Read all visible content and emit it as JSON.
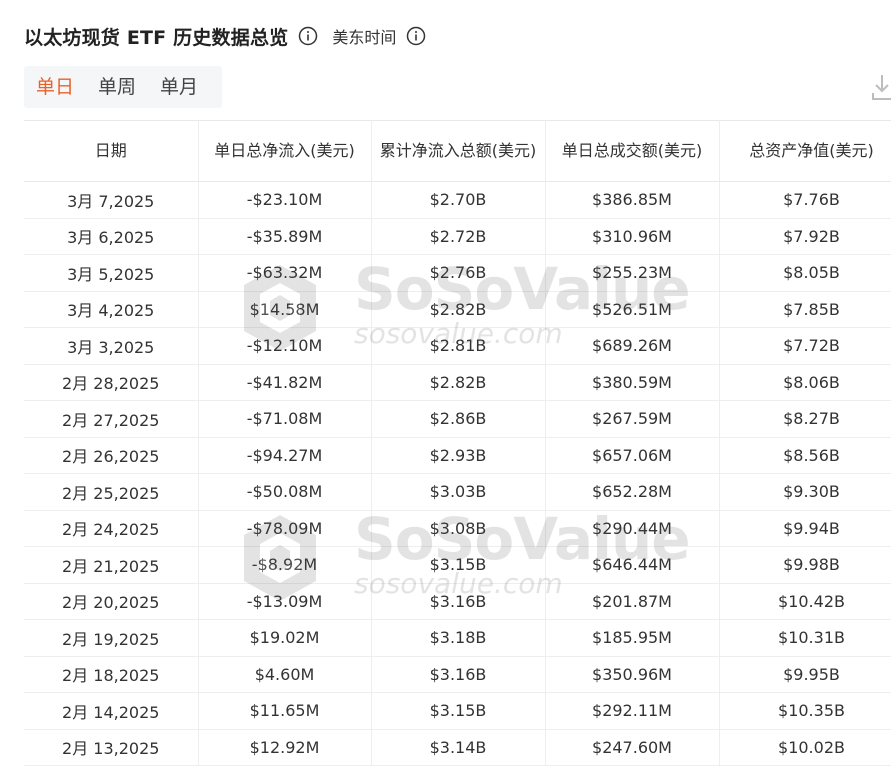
{
  "header": {
    "title": "以太坊现货 ETF 历史数据总览",
    "timezone": "美东时间"
  },
  "tabs": [
    "单日",
    "单周",
    "单月"
  ],
  "active_tab": "单日",
  "table": {
    "columns": [
      "日期",
      "单日总净流入(美元)",
      "累计净流入总额(美元)",
      "单日总成交额(美元)",
      "总资产净值(美元)"
    ],
    "rows": [
      {
        "date": "3月 7,2025",
        "net_inflow": "-$23.10M",
        "cumulative": "$2.70B",
        "volume": "$386.85M",
        "nav": "$7.76B"
      },
      {
        "date": "3月 6,2025",
        "net_inflow": "-$35.89M",
        "cumulative": "$2.72B",
        "volume": "$310.96M",
        "nav": "$7.92B"
      },
      {
        "date": "3月 5,2025",
        "net_inflow": "-$63.32M",
        "cumulative": "$2.76B",
        "volume": "$255.23M",
        "nav": "$8.05B"
      },
      {
        "date": "3月 4,2025",
        "net_inflow": "$14.58M",
        "cumulative": "$2.82B",
        "volume": "$526.51M",
        "nav": "$7.85B"
      },
      {
        "date": "3月 3,2025",
        "net_inflow": "-$12.10M",
        "cumulative": "$2.81B",
        "volume": "$689.26M",
        "nav": "$7.72B"
      },
      {
        "date": "2月 28,2025",
        "net_inflow": "-$41.82M",
        "cumulative": "$2.82B",
        "volume": "$380.59M",
        "nav": "$8.06B"
      },
      {
        "date": "2月 27,2025",
        "net_inflow": "-$71.08M",
        "cumulative": "$2.86B",
        "volume": "$267.59M",
        "nav": "$8.27B"
      },
      {
        "date": "2月 26,2025",
        "net_inflow": "-$94.27M",
        "cumulative": "$2.93B",
        "volume": "$657.06M",
        "nav": "$8.56B"
      },
      {
        "date": "2月 25,2025",
        "net_inflow": "-$50.08M",
        "cumulative": "$3.03B",
        "volume": "$652.28M",
        "nav": "$9.30B"
      },
      {
        "date": "2月 24,2025",
        "net_inflow": "-$78.09M",
        "cumulative": "$3.08B",
        "volume": "$290.44M",
        "nav": "$9.94B"
      },
      {
        "date": "2月 21,2025",
        "net_inflow": "-$8.92M",
        "cumulative": "$3.15B",
        "volume": "$646.44M",
        "nav": "$9.98B"
      },
      {
        "date": "2月 20,2025",
        "net_inflow": "-$13.09M",
        "cumulative": "$3.16B",
        "volume": "$201.87M",
        "nav": "$10.42B"
      },
      {
        "date": "2月 19,2025",
        "net_inflow": "$19.02M",
        "cumulative": "$3.18B",
        "volume": "$185.95M",
        "nav": "$10.31B"
      },
      {
        "date": "2月 18,2025",
        "net_inflow": "$4.60M",
        "cumulative": "$3.16B",
        "volume": "$350.96M",
        "nav": "$9.95B"
      },
      {
        "date": "2月 14,2025",
        "net_inflow": "$11.65M",
        "cumulative": "$3.15B",
        "volume": "$292.11M",
        "nav": "$10.35B"
      },
      {
        "date": "2月 13,2025",
        "net_inflow": "$12.92M",
        "cumulative": "$3.14B",
        "volume": "$247.60M",
        "nav": "$10.02B"
      }
    ]
  },
  "watermark": {
    "brand": "SoSoValue",
    "url": "sosovalue.com"
  },
  "icons": {
    "info": "info-circle-icon",
    "download": "download-icon"
  },
  "colors": {
    "accent": "#e8622a",
    "negative": "#d9452b",
    "positive": "#1f9e4a"
  }
}
